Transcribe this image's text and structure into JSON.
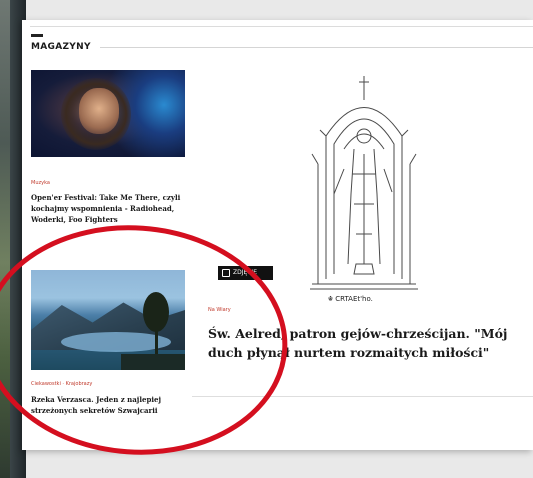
{
  "section": {
    "title": "MAGAZYNY"
  },
  "articles": [
    {
      "category": "Muzyka",
      "headline": "Open'er Festival: Take Me There, czyli kochajmy wspomnienia - Radiohead, Woderki, Foo Fighters"
    },
    {
      "category": "Ciekawostki · Krajobrazy",
      "headline": "Rzeka Verzasca. Jeden z najlepiej strzeżonych sekretów Szwajcarii"
    }
  ],
  "featured": {
    "badge": "ZDJĘCIE",
    "caption": "☬ CRTAEt'ho.",
    "category": "Na Wiary",
    "headline": "Św. Aelred, patron gejów-chrześcijan. \"Mój duch płynął nurtem rozmaitych miłości\""
  },
  "colors": {
    "accent": "#c0392b",
    "annotation": "#d40f1f"
  }
}
